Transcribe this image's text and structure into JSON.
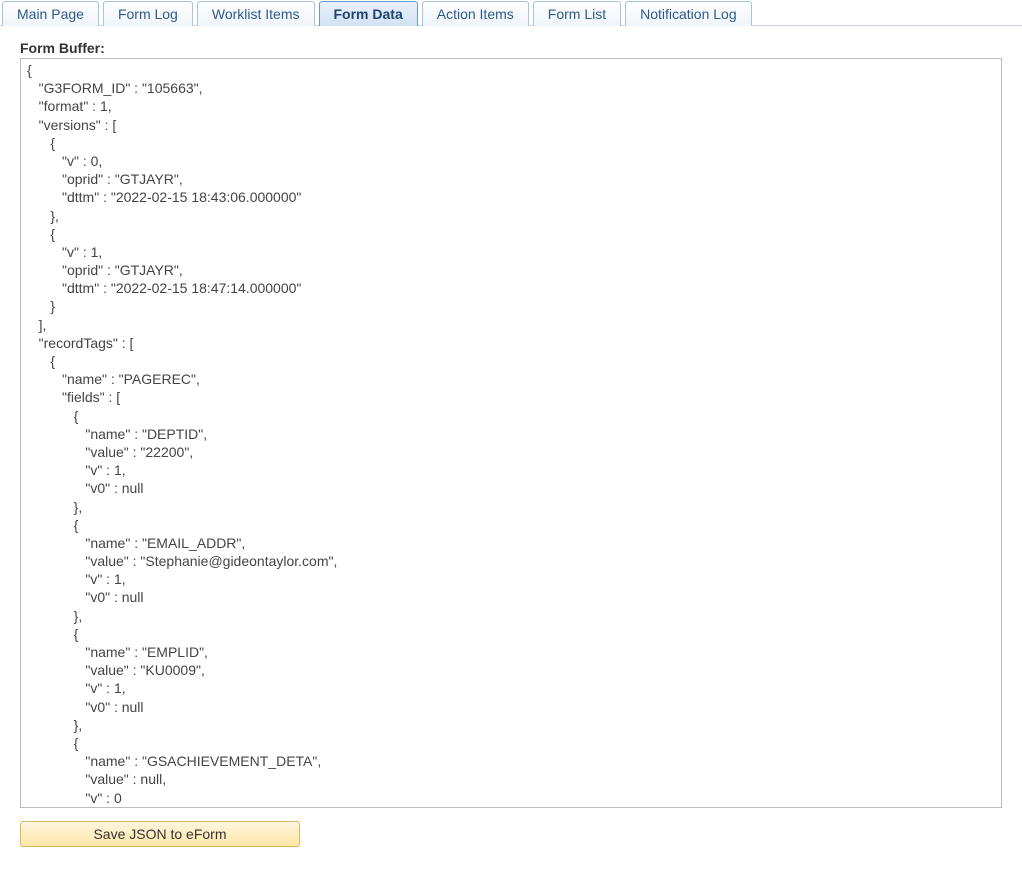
{
  "tabs": [
    {
      "label": "Main Page",
      "active": false
    },
    {
      "label": "Form Log",
      "active": false
    },
    {
      "label": "Worklist Items",
      "active": false
    },
    {
      "label": "Form Data",
      "active": true
    },
    {
      "label": "Action Items",
      "active": false
    },
    {
      "label": "Form List",
      "active": false
    },
    {
      "label": "Notification Log",
      "active": false
    }
  ],
  "section": {
    "buffer_label": "Form Buffer:"
  },
  "buffer_text": "{\n   \"G3FORM_ID\" : \"105663\",\n   \"format\" : 1,\n   \"versions\" : [\n      {\n         \"v\" : 0,\n         \"oprid\" : \"GTJAYR\",\n         \"dttm\" : \"2022-02-15 18:43:06.000000\"\n      },\n      {\n         \"v\" : 1,\n         \"oprid\" : \"GTJAYR\",\n         \"dttm\" : \"2022-02-15 18:47:14.000000\"\n      }\n   ],\n   \"recordTags\" : [\n      {\n         \"name\" : \"PAGEREC\",\n         \"fields\" : [\n            {\n               \"name\" : \"DEPTID\",\n               \"value\" : \"22200\",\n               \"v\" : 1,\n               \"v0\" : null\n            },\n            {\n               \"name\" : \"EMAIL_ADDR\",\n               \"value\" : \"Stephanie@gideontaylor.com\",\n               \"v\" : 1,\n               \"v0\" : null\n            },\n            {\n               \"name\" : \"EMPLID\",\n               \"value\" : \"KU0009\",\n               \"v\" : 1,\n               \"v0\" : null\n            },\n            {\n               \"name\" : \"GSACHIEVEMENT_DETA\",\n               \"value\" : null,\n               \"v\" : 0",
  "actions": {
    "save_label": "Save JSON to eForm"
  }
}
